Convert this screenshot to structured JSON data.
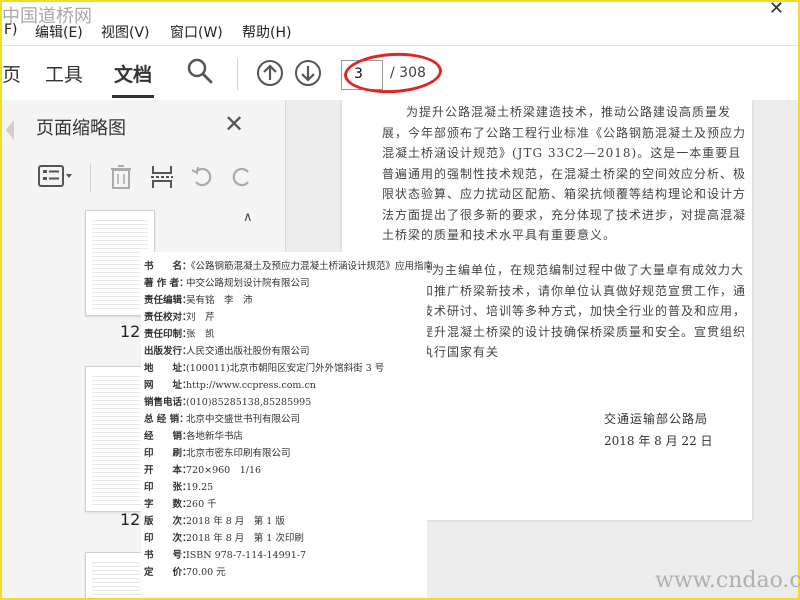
{
  "watermark_top": "中国道桥网",
  "watermark_bottom": "www.cndao.com",
  "menu": {
    "file_fragment": "F)",
    "edit": "编辑(E)",
    "view": "视图(V)",
    "window": "窗口(W)",
    "help": "帮助(H)"
  },
  "toolbar": {
    "tab_fragment": "页",
    "tools": "工具",
    "document": "文档",
    "page_current": "3",
    "page_total": "/ 308"
  },
  "panel": {
    "title": "页面缩略图",
    "thumb_labels": [
      "125",
      "126"
    ]
  },
  "document": {
    "para1": "为提升公路混凝土桥梁建造技术，推动公路建设高质量发展，今年部颁布了公路工程行业标准《公路钢筋混凝土及预应力混凝土桥涵设计规范》(JTG 33C2—2018)。这是一本重要且普遍通用的强制性技术规范，在混凝土桥梁的空间效应分析、极限状态验算、应力扰动区配筋、箱梁抗倾覆等结构理论和设计方法方面提出了很多新的要求，充分体现了技术进步，对提高混凝土桥梁的质量和技术水平具有重要意义。",
    "para2": "位作为主编单位，在规范编制过程中做了大量卓有成效力大力宣传和推广桥梁新技术，请你单位认真做好规范宣贯工作，通过组织技术研讨、培训等多种方式，加快全行业的普及和应用，进一步提升混凝土桥梁的设计技确保桥梁质量和安全。宣贯组织应严格执行国家有关",
    "sign_org": "交通运输部公路局",
    "sign_date": "2018 年 8 月 22 日"
  },
  "copyright": [
    {
      "label": "书　　名：",
      "value": "《公路钢筋混凝土及预应力混凝土桥涵设计规范》应用指南"
    },
    {
      "label": "著 作 者：",
      "value": "中交公路规划设计院有限公司"
    },
    {
      "label": "责任编辑：",
      "value": "吴有铭　李　沛"
    },
    {
      "label": "责任校对：",
      "value": "刘　芹"
    },
    {
      "label": "责任印制：",
      "value": "张　凯"
    },
    {
      "label": "出版发行：",
      "value": "人民交通出版社股份有限公司"
    },
    {
      "label": "地　　址：",
      "value": "(100011)北京市朝阳区安定门外外馆斜街 3 号"
    },
    {
      "label": "网　　址：",
      "value": "http://www.ccpress.com.cn"
    },
    {
      "label": "销售电话：",
      "value": "(010)85285138,85285995"
    },
    {
      "label": "总 经 销：",
      "value": "北京中交盛世书刊有限公司"
    },
    {
      "label": "经　　销：",
      "value": "各地新华书店"
    },
    {
      "label": "印　　刷：",
      "value": "北京市密东印刷有限公司"
    },
    {
      "label": "开　　本：",
      "value": "720×960　1/16"
    },
    {
      "label": "印　　张：",
      "value": "19.25"
    },
    {
      "label": "字　　数：",
      "value": "260 千"
    },
    {
      "label": "版　　次：",
      "value": "2018 年 8 月　第 1 版"
    },
    {
      "label": "印　　次：",
      "value": "2018 年 8 月　第 1 次印刷"
    },
    {
      "label": "书　　号：",
      "value": "ISBN 978-7-114-14991-7"
    },
    {
      "label": "定　　价：",
      "value": "70.00 元"
    }
  ]
}
